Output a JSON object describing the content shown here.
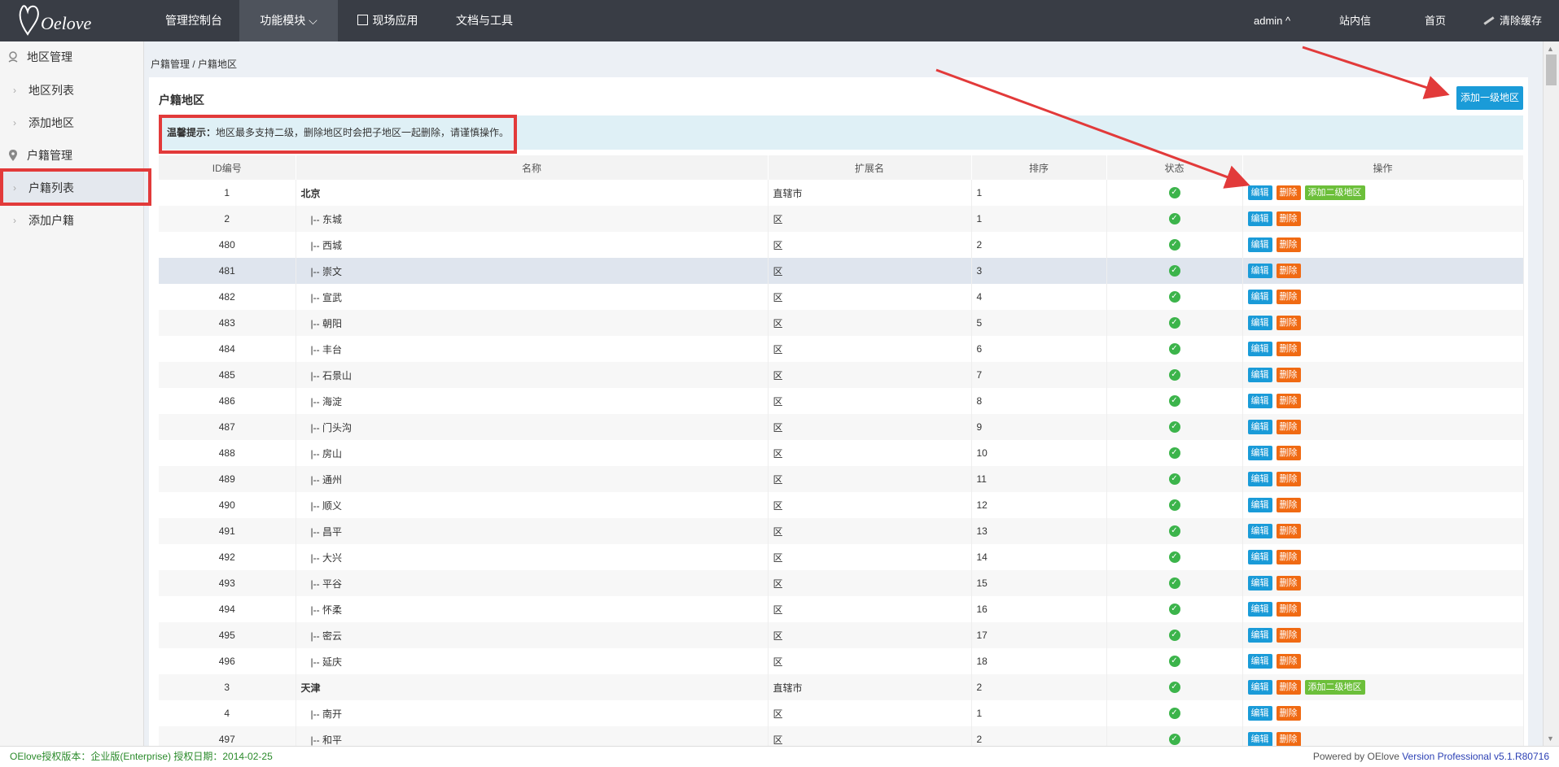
{
  "topbar": {
    "logo_text": "Oelove",
    "nav": [
      {
        "label": "管理控制台"
      },
      {
        "label": "功能模块",
        "suffix": "⌵"
      },
      {
        "label": "现场应用"
      },
      {
        "label": "文档与工具"
      }
    ],
    "user": "admin ^",
    "messages": "站内信",
    "home": "首页",
    "clear_cache": "清除缓存"
  },
  "sidebar": {
    "groups": [
      {
        "label": "地区管理",
        "items": [
          {
            "label": "地区列表"
          },
          {
            "label": "添加地区"
          }
        ]
      },
      {
        "label": "户籍管理",
        "items": [
          {
            "label": "户籍列表"
          },
          {
            "label": "添加户籍"
          }
        ]
      }
    ]
  },
  "breadcrumb": "户籍管理 / 户籍地区",
  "panel": {
    "title": "户籍地区",
    "add_button": "添加一级地区",
    "tip_label": "温馨提示：",
    "tip_text": "地区最多支持二级，删除地区时会把子地区一起删除，请谨慎操作。"
  },
  "table": {
    "columns": [
      "ID编号",
      "名称",
      "扩展名",
      "排序",
      "状态",
      "操作"
    ],
    "edit_label": "编辑",
    "delete_label": "删除",
    "add_child_label": "添加二级地区",
    "rows": [
      {
        "id": "1",
        "name": "北京",
        "ext": "直辖市",
        "sort": "1",
        "top": true
      },
      {
        "id": "2",
        "name": "|-- 东城",
        "ext": "区",
        "sort": "1"
      },
      {
        "id": "480",
        "name": "|-- 西城",
        "ext": "区",
        "sort": "2"
      },
      {
        "id": "481",
        "name": "|-- 崇文",
        "ext": "区",
        "sort": "3"
      },
      {
        "id": "482",
        "name": "|-- 宣武",
        "ext": "区",
        "sort": "4"
      },
      {
        "id": "483",
        "name": "|-- 朝阳",
        "ext": "区",
        "sort": "5"
      },
      {
        "id": "484",
        "name": "|-- 丰台",
        "ext": "区",
        "sort": "6"
      },
      {
        "id": "485",
        "name": "|-- 石景山",
        "ext": "区",
        "sort": "7"
      },
      {
        "id": "486",
        "name": "|-- 海淀",
        "ext": "区",
        "sort": "8"
      },
      {
        "id": "487",
        "name": "|-- 门头沟",
        "ext": "区",
        "sort": "9"
      },
      {
        "id": "488",
        "name": "|-- 房山",
        "ext": "区",
        "sort": "10"
      },
      {
        "id": "489",
        "name": "|-- 通州",
        "ext": "区",
        "sort": "11"
      },
      {
        "id": "490",
        "name": "|-- 顺义",
        "ext": "区",
        "sort": "12"
      },
      {
        "id": "491",
        "name": "|-- 昌平",
        "ext": "区",
        "sort": "13"
      },
      {
        "id": "492",
        "name": "|-- 大兴",
        "ext": "区",
        "sort": "14"
      },
      {
        "id": "493",
        "name": "|-- 平谷",
        "ext": "区",
        "sort": "15"
      },
      {
        "id": "494",
        "name": "|-- 怀柔",
        "ext": "区",
        "sort": "16"
      },
      {
        "id": "495",
        "name": "|-- 密云",
        "ext": "区",
        "sort": "17"
      },
      {
        "id": "496",
        "name": "|-- 延庆",
        "ext": "区",
        "sort": "18"
      },
      {
        "id": "3",
        "name": "天津",
        "ext": "直辖市",
        "sort": "2",
        "top": true
      },
      {
        "id": "4",
        "name": "|-- 南开",
        "ext": "区",
        "sort": "1"
      },
      {
        "id": "497",
        "name": "|-- 和平",
        "ext": "区",
        "sort": "2"
      }
    ]
  },
  "footer": {
    "license": "OElove授权版本：企业版(Enterprise) 授权日期：2014-02-25",
    "powered": "Powered by OElove",
    "version": "Version Professional v5.1.R80716"
  },
  "colors": {
    "topbar": "#393d45",
    "primary_button": "#1a9bd8",
    "danger_button": "#f06a13",
    "success_button": "#6cbf3a",
    "annotation_red": "#e23a3a"
  },
  "icons": [
    "location-pin-icon",
    "map-marker-icon",
    "cube-icon",
    "broom-icon",
    "chevron-right-icon",
    "check-circle-icon"
  ]
}
